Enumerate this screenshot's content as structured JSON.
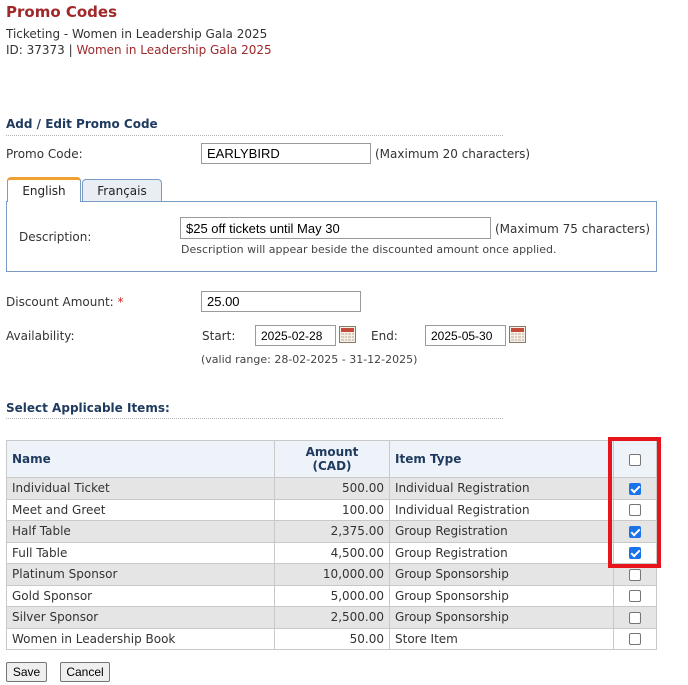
{
  "page": {
    "title": "Promo Codes",
    "subtitle": "Ticketing - Women in Leadership Gala 2025",
    "id_label": "ID: 37373 | ",
    "event_link": "Women in Leadership Gala 2025"
  },
  "form": {
    "section_title": "Add / Edit Promo Code",
    "promo_code_label": "Promo Code:",
    "promo_code_value": "EARLYBIRD",
    "promo_code_hint": "(Maximum 20 characters)",
    "tabs": [
      {
        "label": "English",
        "active": true
      },
      {
        "label": "Français",
        "active": false
      }
    ],
    "description_label": "Description:",
    "description_value": "$25 off tickets until May 30",
    "description_hint": "(Maximum 75 characters)",
    "description_note": "Description will appear beside the discounted amount once applied.",
    "discount_label": "Discount Amount: ",
    "discount_required_mark": "*",
    "discount_value": "25.00",
    "availability_label": "Availability:",
    "start_label": "Start:",
    "start_value": "2025-02-28",
    "end_label": "End:",
    "end_value": "2025-05-30",
    "valid_range": "(valid range: 28-02-2025 - 31-12-2025)"
  },
  "items": {
    "section_title": "Select Applicable Items:",
    "columns": {
      "name": "Name",
      "amount_line1": "Amount",
      "amount_line2": "(CAD)",
      "item_type": "Item Type"
    },
    "select_all_checked": false,
    "rows": [
      {
        "name": "Individual Ticket",
        "amount": "500.00",
        "type": "Individual Registration",
        "checked": true
      },
      {
        "name": "Meet and Greet",
        "amount": "100.00",
        "type": "Individual Registration",
        "checked": false
      },
      {
        "name": "Half Table",
        "amount": "2,375.00",
        "type": "Group Registration",
        "checked": true
      },
      {
        "name": "Full Table",
        "amount": "4,500.00",
        "type": "Group Registration",
        "checked": true
      },
      {
        "name": "Platinum Sponsor",
        "amount": "10,000.00",
        "type": "Group Sponsorship",
        "checked": false
      },
      {
        "name": "Gold Sponsor",
        "amount": "5,000.00",
        "type": "Group Sponsorship",
        "checked": false
      },
      {
        "name": "Silver Sponsor",
        "amount": "2,500.00",
        "type": "Group Sponsorship",
        "checked": false
      },
      {
        "name": "Women in Leadership Book",
        "amount": "50.00",
        "type": "Store Item",
        "checked": false
      }
    ]
  },
  "actions": {
    "save_label": "Save",
    "cancel_label": "Cancel"
  },
  "colors": {
    "title": "#a0282a",
    "section_heading": "#1e3a5f",
    "highlight_box": "#e8141c",
    "checkbox_checked": "#1a73e8"
  }
}
